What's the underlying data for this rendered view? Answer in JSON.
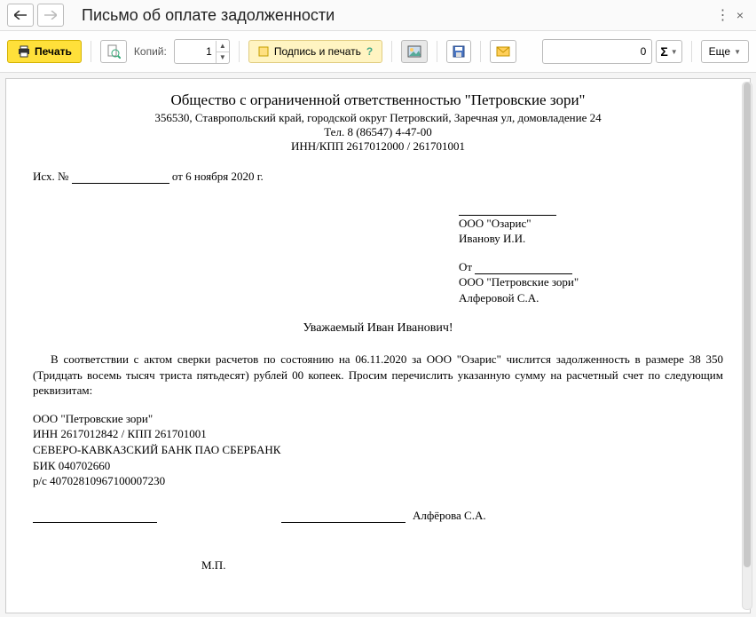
{
  "window": {
    "title": "Письмо об оплате задолженности"
  },
  "toolbar": {
    "print_label": "Печать",
    "copies_label": "Копий:",
    "copies_value": "1",
    "sign_label": "Подпись и печать",
    "sum_value": "0",
    "more_label": "Еще"
  },
  "doc": {
    "org_full": "Общество с ограниченной ответственностью \"Петровские зори\"",
    "address": "356530, Ставропольский край, городской округ Петровский, Заречная ул, домовладение 24",
    "phone": "Тел. 8 (86547) 4-47-00",
    "innkpp": "ИНН/КПП 2617012000 / 261701001",
    "outgoing_prefix": "Исх. №",
    "outgoing_date_prefix": "от",
    "outgoing_date": "6 ноября 2020 г.",
    "recipient_org": "ООО \"Озарис\"",
    "recipient_person": "Иванову  И.И.",
    "from_label": "От",
    "sender_org": "ООО \"Петровские зори\"",
    "sender_person": "Алферовой С.А.",
    "salutation": "Уважаемый Иван Иванович!",
    "body": "В соответствии с актом сверки расчетов по состоянию на 06.11.2020 за ООО \"Озарис\" числится задолженность в размере 38 350 (Тридцать восемь тысяч триста пятьдесят) рублей 00 копеек. Просим перечислить указанную сумму на расчетный счет  по следующим реквизитам:",
    "req_org": "ООО \"Петровские зори\"",
    "req_inn": "ИНН 2617012842 / КПП 261701001",
    "req_bank": "СЕВЕРО-КАВКАЗСКИЙ БАНК ПАО СБЕРБАНК",
    "req_bik": "БИК 040702660",
    "req_acc": "р/с 40702810967100007230",
    "signer": "Алфёрова С.А.",
    "stamp_label": "М.П."
  }
}
